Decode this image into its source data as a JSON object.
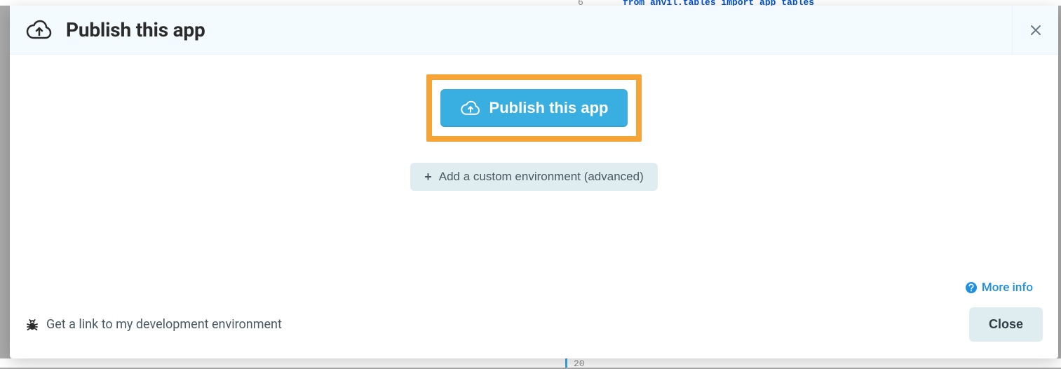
{
  "background": {
    "code_line_number": "6",
    "code_snippet": "from anvil.tables import app_tables",
    "bottom_line_number": "20"
  },
  "modal": {
    "title": "Publish this app",
    "publish_button_label": "Publish this app",
    "advanced_button_label": "Add a custom environment (advanced)",
    "more_info_label": "More info",
    "dev_link_label": "Get a link to my development environment",
    "close_button_label": "Close"
  }
}
